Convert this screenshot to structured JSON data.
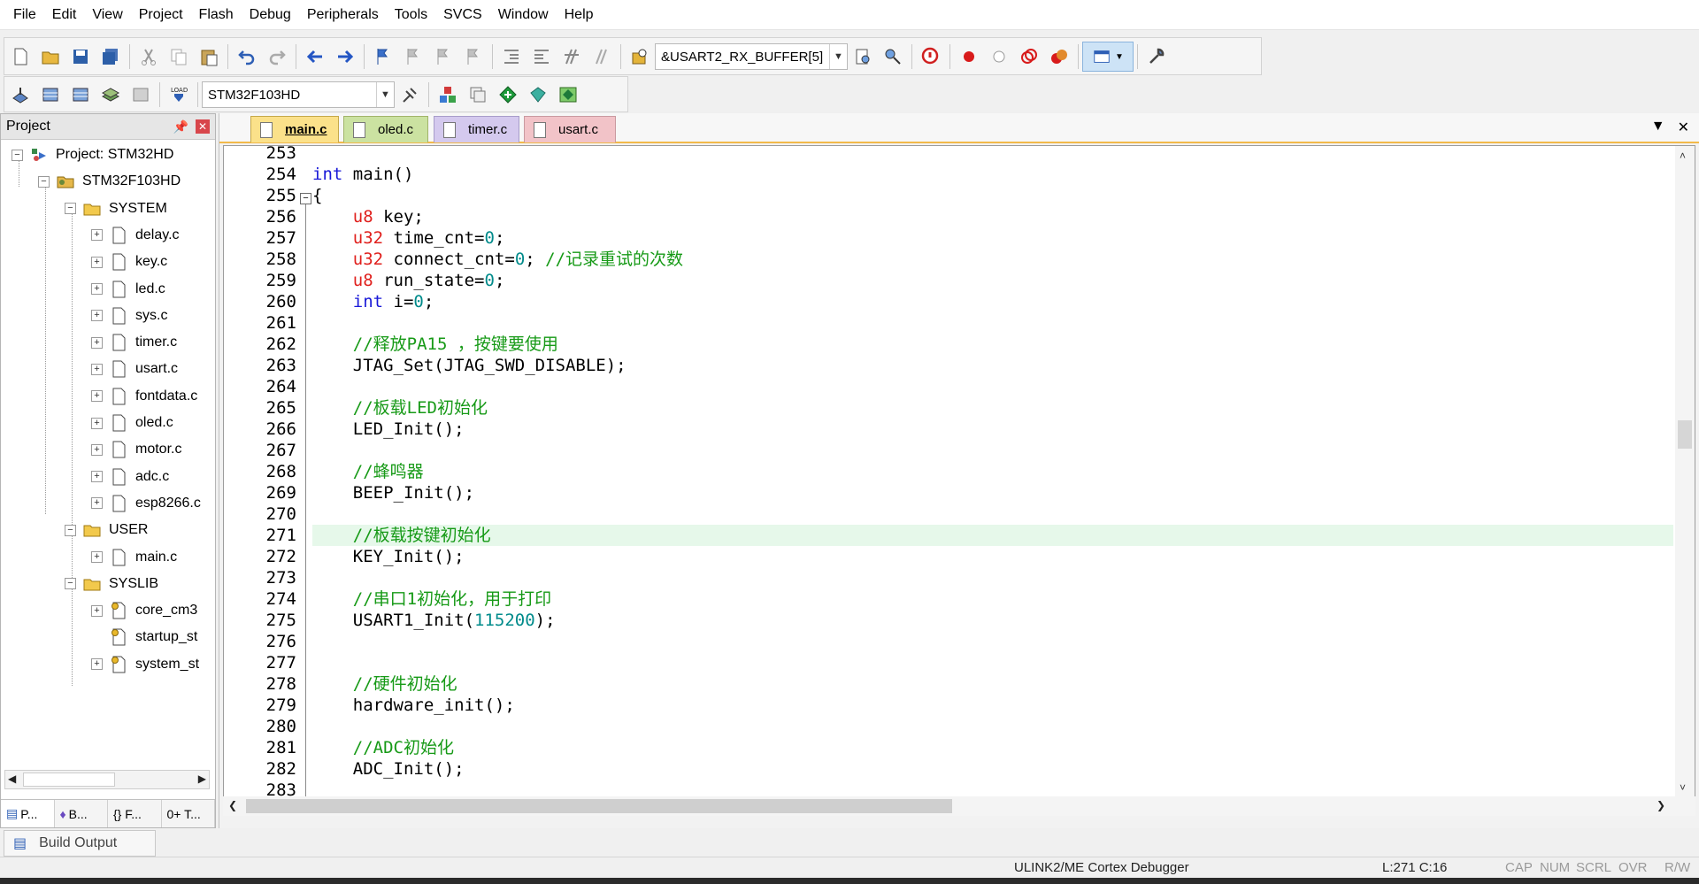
{
  "menu": [
    "File",
    "Edit",
    "View",
    "Project",
    "Flash",
    "Debug",
    "Peripherals",
    "Tools",
    "SVCS",
    "Window",
    "Help"
  ],
  "toolbar": {
    "symbol_combo": "&USART2_RX_BUFFER[5]",
    "target_combo": "STM32F103HD"
  },
  "project": {
    "title": "Project",
    "tree": [
      {
        "label": "Project: STM32HD",
        "level": 0,
        "kind": "project",
        "expander": "−"
      },
      {
        "label": "STM32F103HD",
        "level": 1,
        "kind": "target",
        "expander": "−"
      },
      {
        "label": "SYSTEM",
        "level": 2,
        "kind": "folder",
        "expander": "−"
      },
      {
        "label": "delay.c",
        "level": 3,
        "kind": "file",
        "expander": "+"
      },
      {
        "label": "key.c",
        "level": 3,
        "kind": "file",
        "expander": "+"
      },
      {
        "label": "led.c",
        "level": 3,
        "kind": "file",
        "expander": "+"
      },
      {
        "label": "sys.c",
        "level": 3,
        "kind": "file",
        "expander": "+"
      },
      {
        "label": "timer.c",
        "level": 3,
        "kind": "file",
        "expander": "+"
      },
      {
        "label": "usart.c",
        "level": 3,
        "kind": "file",
        "expander": "+"
      },
      {
        "label": "fontdata.c",
        "level": 3,
        "kind": "file",
        "expander": "+"
      },
      {
        "label": "oled.c",
        "level": 3,
        "kind": "file",
        "expander": "+"
      },
      {
        "label": "motor.c",
        "level": 3,
        "kind": "file",
        "expander": "+"
      },
      {
        "label": "adc.c",
        "level": 3,
        "kind": "file",
        "expander": "+"
      },
      {
        "label": "esp8266.c",
        "level": 3,
        "kind": "file",
        "expander": "+"
      },
      {
        "label": "USER",
        "level": 2,
        "kind": "folder",
        "expander": "−"
      },
      {
        "label": "main.c",
        "level": 3,
        "kind": "file",
        "expander": "+"
      },
      {
        "label": "SYSLIB",
        "level": 2,
        "kind": "folder",
        "expander": "−"
      },
      {
        "label": "core_cm3",
        "level": 3,
        "kind": "libfile",
        "expander": "+"
      },
      {
        "label": "startup_st",
        "level": 3,
        "kind": "libfile",
        "expander": ""
      },
      {
        "label": "system_st",
        "level": 3,
        "kind": "libfile",
        "expander": "+"
      }
    ],
    "tabs": [
      "P...",
      "B...",
      "{} F...",
      "0+ T..."
    ]
  },
  "editor": {
    "tabs": [
      "main.c",
      "oled.c",
      "timer.c",
      "usart.c"
    ],
    "active_tab": "main.c",
    "current_line": 271,
    "lines": [
      {
        "n": "253",
        "tokens": []
      },
      {
        "n": "254",
        "tokens": [
          {
            "t": "int",
            "c": "kw"
          },
          {
            "t": " main()",
            "c": ""
          }
        ]
      },
      {
        "n": "255",
        "tokens": [
          {
            "t": "{",
            "c": ""
          }
        ],
        "fold": "−"
      },
      {
        "n": "256",
        "tokens": [
          {
            "t": "    ",
            "c": ""
          },
          {
            "t": "u8",
            "c": "ty"
          },
          {
            "t": " key;",
            "c": ""
          }
        ]
      },
      {
        "n": "257",
        "tokens": [
          {
            "t": "    ",
            "c": ""
          },
          {
            "t": "u32",
            "c": "ty"
          },
          {
            "t": " time_cnt=",
            "c": ""
          },
          {
            "t": "0",
            "c": "num"
          },
          {
            "t": ";",
            "c": ""
          }
        ]
      },
      {
        "n": "258",
        "tokens": [
          {
            "t": "    ",
            "c": ""
          },
          {
            "t": "u32",
            "c": "ty"
          },
          {
            "t": " connect_cnt=",
            "c": ""
          },
          {
            "t": "0",
            "c": "num"
          },
          {
            "t": "; ",
            "c": ""
          },
          {
            "t": "//记录重试的次数",
            "c": "cm"
          }
        ]
      },
      {
        "n": "259",
        "tokens": [
          {
            "t": "    ",
            "c": ""
          },
          {
            "t": "u8",
            "c": "ty"
          },
          {
            "t": " run_state=",
            "c": ""
          },
          {
            "t": "0",
            "c": "num"
          },
          {
            "t": ";",
            "c": ""
          }
        ]
      },
      {
        "n": "260",
        "tokens": [
          {
            "t": "    ",
            "c": ""
          },
          {
            "t": "int",
            "c": "kw"
          },
          {
            "t": " i=",
            "c": ""
          },
          {
            "t": "0",
            "c": "num"
          },
          {
            "t": ";",
            "c": ""
          }
        ]
      },
      {
        "n": "261",
        "tokens": []
      },
      {
        "n": "262",
        "tokens": [
          {
            "t": "    ",
            "c": ""
          },
          {
            "t": "//释放PA15 ，按键要使用",
            "c": "cm"
          }
        ]
      },
      {
        "n": "263",
        "tokens": [
          {
            "t": "    JTAG_Set(JTAG_SWD_DISABLE);",
            "c": ""
          }
        ]
      },
      {
        "n": "264",
        "tokens": []
      },
      {
        "n": "265",
        "tokens": [
          {
            "t": "    ",
            "c": ""
          },
          {
            "t": "//板载LED初始化",
            "c": "cm"
          }
        ]
      },
      {
        "n": "266",
        "tokens": [
          {
            "t": "    LED_Init();",
            "c": ""
          }
        ]
      },
      {
        "n": "267",
        "tokens": []
      },
      {
        "n": "268",
        "tokens": [
          {
            "t": "    ",
            "c": ""
          },
          {
            "t": "//蜂鸣器",
            "c": "cm"
          }
        ]
      },
      {
        "n": "269",
        "tokens": [
          {
            "t": "    BEEP_Init();",
            "c": ""
          }
        ]
      },
      {
        "n": "270",
        "tokens": []
      },
      {
        "n": "271",
        "tokens": [
          {
            "t": "    ",
            "c": ""
          },
          {
            "t": "//板载按键初始化",
            "c": "cm"
          }
        ]
      },
      {
        "n": "272",
        "tokens": [
          {
            "t": "    KEY_Init();",
            "c": ""
          }
        ]
      },
      {
        "n": "273",
        "tokens": []
      },
      {
        "n": "274",
        "tokens": [
          {
            "t": "    ",
            "c": ""
          },
          {
            "t": "//串口1初始化，用于打印",
            "c": "cm"
          }
        ]
      },
      {
        "n": "275",
        "tokens": [
          {
            "t": "    USART1_Init(",
            "c": ""
          },
          {
            "t": "115200",
            "c": "num"
          },
          {
            "t": ");",
            "c": ""
          }
        ]
      },
      {
        "n": "276",
        "tokens": []
      },
      {
        "n": "277",
        "tokens": []
      },
      {
        "n": "278",
        "tokens": [
          {
            "t": "    ",
            "c": ""
          },
          {
            "t": "//硬件初始化",
            "c": "cm"
          }
        ]
      },
      {
        "n": "279",
        "tokens": [
          {
            "t": "    hardware_init();",
            "c": ""
          }
        ]
      },
      {
        "n": "280",
        "tokens": []
      },
      {
        "n": "281",
        "tokens": [
          {
            "t": "    ",
            "c": ""
          },
          {
            "t": "//ADC初始化",
            "c": "cm"
          }
        ]
      },
      {
        "n": "282",
        "tokens": [
          {
            "t": "    ADC_Init();",
            "c": ""
          }
        ]
      },
      {
        "n": "283",
        "tokens": []
      }
    ]
  },
  "bottom": {
    "build_output_tab": "Build Output"
  },
  "status": {
    "debugger": "ULINK2/ME Cortex Debugger",
    "position": "L:271 C:16",
    "indicators": [
      "CAP",
      "NUM",
      "SCRL",
      "OVR",
      "R/W"
    ]
  },
  "colors": {
    "keyword": "#1a1ad8",
    "type": "#e0201d",
    "number": "#008b8b",
    "comment": "#179a17",
    "current_line": "#e6f8ea",
    "tab_main": "#fbe18a",
    "tab_oled": "#cbe2a1",
    "tab_timer": "#d4c9ee",
    "tab_usart": "#f2c3c8"
  }
}
